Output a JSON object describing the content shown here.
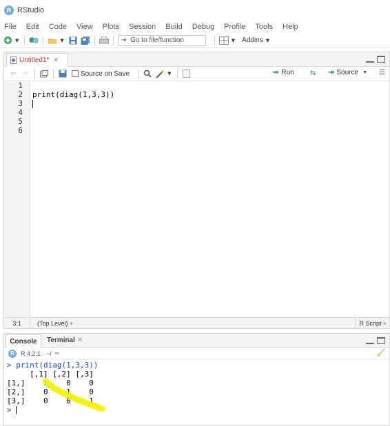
{
  "app": {
    "title": "RStudio",
    "logo_letter": "R"
  },
  "menu": {
    "items": [
      "File",
      "Edit",
      "Code",
      "View",
      "Plots",
      "Session",
      "Build",
      "Debug",
      "Profile",
      "Tools",
      "Help"
    ]
  },
  "toolbar": {
    "goto_label": "Go to file/function",
    "addins_label": "Addins"
  },
  "editor": {
    "tab_label": "Untitled1*",
    "source_on_save_label": "Source on Save",
    "run_label": "Run",
    "source_label": "Source",
    "line_numbers": [
      "1",
      "2",
      "3",
      "4",
      "5",
      "6"
    ],
    "lines": [
      "",
      "print(diag(1,3,3))",
      "",
      "",
      "",
      ""
    ],
    "status_position": "3:1",
    "status_scope": "(Top Level) ÷",
    "status_filetype": "R Script ÷"
  },
  "console": {
    "tab_console": "Console",
    "tab_terminal": "Terminal",
    "version": "R 4.2.1 · ~/",
    "lines": [
      {
        "text": "> print(diag(1,3,3))",
        "kind": "cmd"
      },
      {
        "text": "     [,1] [,2] [,3]",
        "kind": "out"
      },
      {
        "text": "[1,]    1    0    0",
        "kind": "out"
      },
      {
        "text": "[2,]    0    1    0",
        "kind": "out"
      },
      {
        "text": "[3,]    0    0    1",
        "kind": "out"
      },
      {
        "text": "> ",
        "kind": "prompt"
      }
    ],
    "highlight_color": "#f2f200"
  }
}
